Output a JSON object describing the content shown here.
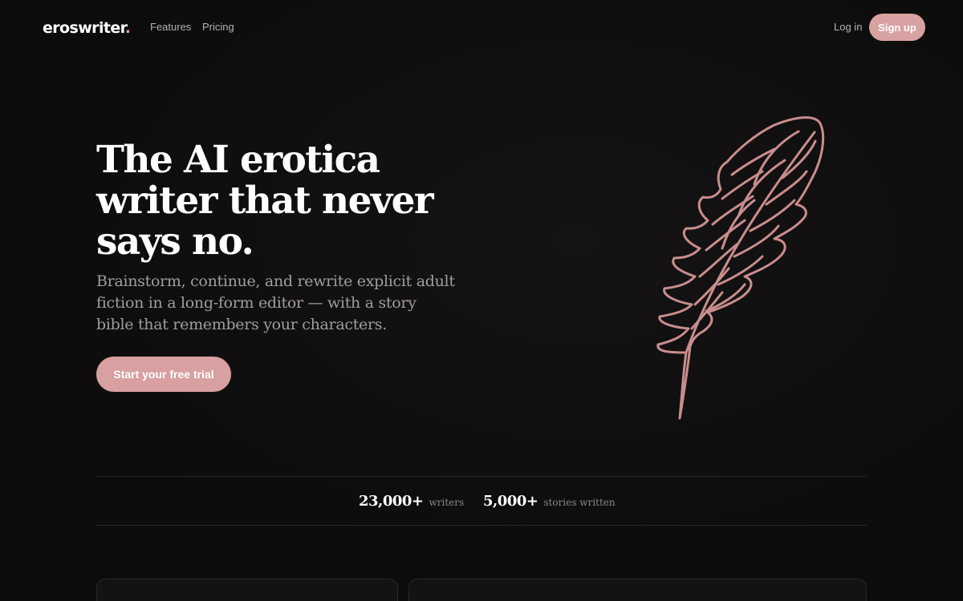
{
  "brand": {
    "name": "eroswriter",
    "dot": ".",
    "accent": "#d9a2a2"
  },
  "nav": {
    "links": [
      "Features",
      "Pricing"
    ],
    "login_label": "Log in",
    "signup_label": "Sign up"
  },
  "hero": {
    "title": "The AI erotica writer that never says no.",
    "subtitle": "Brainstorm, continue, and rewrite explicit adult fiction in a long-form editor — with a story bible that remembers your characters.",
    "cta_label": "Start your free trial",
    "illustration": "feather-icon"
  },
  "stats": [
    {
      "value": "23,000+",
      "label": "writers"
    },
    {
      "value": "5,000+",
      "label": "stories written"
    }
  ]
}
